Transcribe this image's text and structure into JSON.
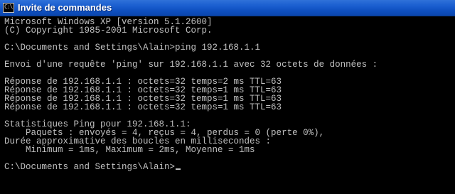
{
  "window": {
    "title": "Invite de commandes",
    "icon_name": "console-icon",
    "icon_text": "C:\\"
  },
  "console": {
    "lines": [
      "Microsoft Windows XP [version 5.1.2600]",
      "(C) Copyright 1985-2001 Microsoft Corp.",
      "",
      "C:\\Documents and Settings\\Alain>ping 192.168.1.1",
      "",
      "Envoi d'une requête 'ping' sur 192.168.1.1 avec 32 octets de données :",
      "",
      "Réponse de 192.168.1.1 : octets=32 temps=2 ms TTL=63",
      "Réponse de 192.168.1.1 : octets=32 temps=1 ms TTL=63",
      "Réponse de 192.168.1.1 : octets=32 temps=1 ms TTL=63",
      "Réponse de 192.168.1.1 : octets=32 temps=1 ms TTL=63",
      "",
      "Statistiques Ping pour 192.168.1.1:",
      "    Paquets : envoyés = 4, reçus = 4, perdus = 0 (perte 0%),",
      "Durée approximative des boucles en millisecondes :",
      "    Minimum = 1ms, Maximum = 2ms, Moyenne = 1ms",
      ""
    ],
    "prompt": "C:\\Documents and Settings\\Alain>",
    "text_color": "#c0c0c0",
    "background_color": "#000000"
  }
}
